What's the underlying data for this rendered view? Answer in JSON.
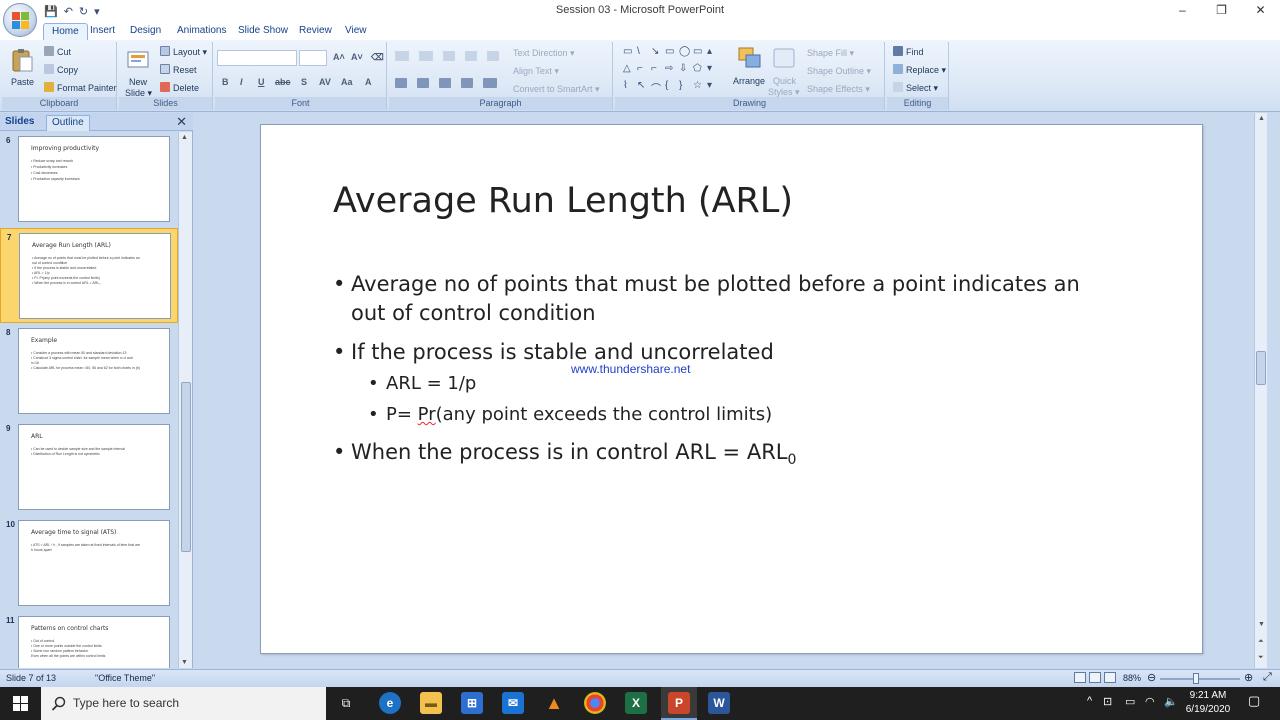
{
  "window": {
    "title": "Session 03 - Microsoft PowerPoint",
    "minimize": "–",
    "maximize": "❐",
    "close": "✕"
  },
  "qat": {
    "save": "💾",
    "undo": "↶",
    "redo": "↻",
    "customize": "▾"
  },
  "ribbon": {
    "tabs": [
      "Home",
      "Insert",
      "Design",
      "Animations",
      "Slide Show",
      "Review",
      "View"
    ],
    "clipboard": {
      "label": "Clipboard",
      "paste": "Paste",
      "cut": "Cut",
      "copy": "Copy",
      "format_painter": "Format Painter"
    },
    "slides": {
      "label": "Slides",
      "new_slide_1": "New",
      "new_slide_2": "Slide ▾",
      "layout": "Layout ▾",
      "reset": "Reset",
      "delete": "Delete"
    },
    "font": {
      "label": "Font",
      "grow": "A˄",
      "shrink": "A˅",
      "clear": "⌫",
      "bold": "B",
      "italic": "I",
      "underline": "U",
      "strike": "abc",
      "shadow": "S",
      "spacing": "AV",
      "case": "Aa",
      "color": "A"
    },
    "paragraph": {
      "label": "Paragraph",
      "text_direction": "Text Direction ▾",
      "align_text": "Align Text ▾",
      "convert_smartart": "Convert to SmartArt ▾"
    },
    "drawing": {
      "label": "Drawing",
      "arrange": "Arrange",
      "quick_styles_1": "Quick",
      "quick_styles_2": "Styles ▾",
      "shape_fill": "Shape Fill ▾",
      "shape_outline": "Shape Outline ▾",
      "shape_effects": "Shape Effects ▾",
      "shapes": [
        "▭",
        "\\",
        "↘",
        "▭",
        "◯",
        "▭",
        "▴",
        "△",
        "⌐",
        "⌐",
        "⇨",
        "⇩",
        "⬠",
        "▾",
        "⌇",
        "↖",
        "⌒",
        "{",
        "}",
        "☆",
        "▾"
      ]
    },
    "editing": {
      "label": "Editing",
      "find": "Find",
      "replace": "Replace ▾",
      "select": "Select ▾"
    }
  },
  "pane": {
    "tab_slides": "Slides",
    "tab_outline": "Outline",
    "close": "✕",
    "thumbnails": [
      {
        "num": "6",
        "title": "Improving productivity",
        "lines": [
          "• Reduce scrap and rework",
          "• Productivity increases",
          "• Cost decreases",
          "• Production capacity increases"
        ]
      },
      {
        "num": "7",
        "title": "Average Run Length (ARL)",
        "lines": [
          "• Average no of points that must be plotted before a point indicates an",
          "   out of control condition",
          "• If the process is stable and uncorrelated",
          "     • ARL = 1/p",
          "     • P= Pr(any point exceeds the control limits)",
          "• When the process is in control ARL = ARL₀"
        ]
      },
      {
        "num": "8",
        "title": "Example",
        "lines": [
          "• Consider a process with mean 50 and standard deviation 13",
          "• Construct 3 sigma control chart. for sample mean when n=4 and",
          "   n=16",
          "• Calculate ARL for process mean =50, 56 and 62 for both charts in (b)"
        ]
      },
      {
        "num": "9",
        "title": "ARL",
        "lines": [
          "• Can be used to decide sample size and the sample interval",
          "• Distribution of Run Length is not symmetric"
        ]
      },
      {
        "num": "10",
        "title": "Average time to signal (ATS)",
        "lines": [
          "• ATS = ARL * h , if samples are taken at fixed intervals of time that are",
          "   h hours apart"
        ]
      },
      {
        "num": "11",
        "title": "Patterns on control charts",
        "lines": [
          "• Out of control",
          "   • One or more points outside the control limits",
          "   • Some non random pattern behavior",
          "   Even when all the points are within control limits"
        ]
      }
    ]
  },
  "slide": {
    "title": "Average Run Length (ARL)",
    "bullet1_line1": "Average no of points that must be plotted before a point indicates an",
    "bullet1_line2": "out of control condition",
    "bullet2": "If the process is stable and uncorrelated",
    "sub1": "ARL = 1/p",
    "sub2_prefix": "P= ",
    "sub2_word": "Pr",
    "sub2_suffix": "(any point exceeds the control limits)",
    "bullet3": "When the process is in control ARL = ARL",
    "bullet3_sub": "0",
    "bullet_char": "•",
    "watermark": "www.thundershare.net"
  },
  "status": {
    "slide": "Slide 7 of 13",
    "theme": "\"Office Theme\"",
    "zoom": "88%",
    "zoom_out": "⊖",
    "zoom_in": "⊕",
    "fit": "⤢"
  },
  "taskbar": {
    "search_placeholder": "Type here to search",
    "apps": [
      "Task View",
      "Edge",
      "File Explorer",
      "Microsoft Store",
      "Mail",
      "VLC",
      "Chrome",
      "Excel",
      "PowerPoint",
      "Word"
    ],
    "time": "9:21 AM",
    "date": "6/19/2020"
  }
}
